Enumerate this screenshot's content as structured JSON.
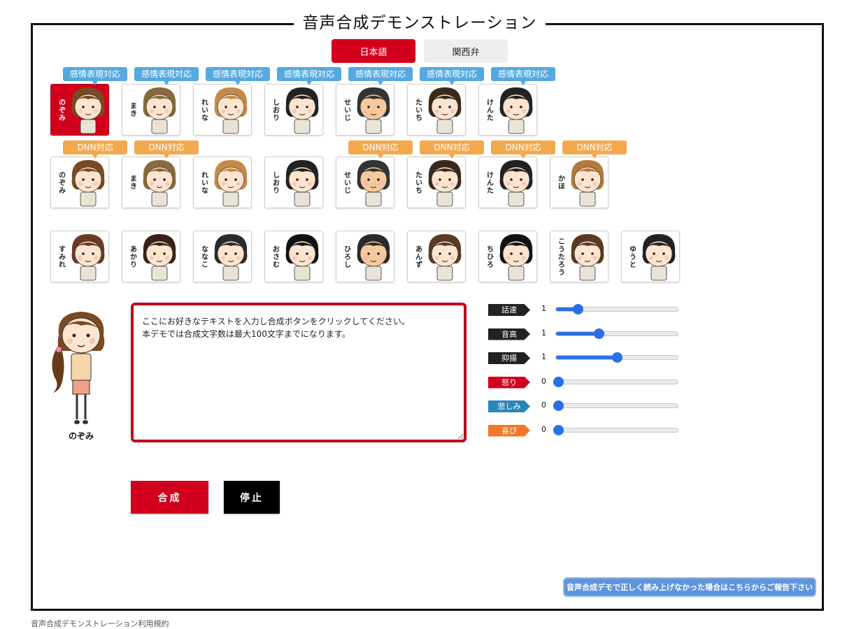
{
  "page": {
    "title": "音声合成デモンストレーション"
  },
  "language_tabs": [
    {
      "label": "日本語",
      "active": true
    },
    {
      "label": "関西弁",
      "active": false
    }
  ],
  "badges": {
    "emotion": "感情表現対応",
    "dnn": "DNN対応"
  },
  "row1": [
    {
      "name": "のぞみ",
      "hair": "#7a4a22",
      "skin": "#fde4cf",
      "badge": "emotion",
      "selected": true
    },
    {
      "name": "まき",
      "hair": "#8a6a3a",
      "skin": "#fde4cf",
      "badge": "emotion"
    },
    {
      "name": "れいな",
      "hair": "#c58a4a",
      "skin": "#fde4cf",
      "badge": "emotion"
    },
    {
      "name": "しおり",
      "hair": "#222222",
      "skin": "#fde4cf",
      "badge": "emotion"
    },
    {
      "name": "せいじ",
      "hair": "#333333",
      "skin": "#f5c99b",
      "badge": "emotion"
    },
    {
      "name": "たいち",
      "hair": "#3a2a1a",
      "skin": "#fde4cf",
      "badge": "emotion"
    },
    {
      "name": "けんた",
      "hair": "#222222",
      "skin": "#fde4cf",
      "badge": "emotion"
    }
  ],
  "row2": [
    {
      "name": "のぞみ",
      "hair": "#7a4a22",
      "skin": "#fde4cf",
      "badge": "dnn"
    },
    {
      "name": "まき",
      "hair": "#8a6a3a",
      "skin": "#fde4cf",
      "badge": "dnn"
    },
    {
      "name": "れいな",
      "hair": "#c58a4a",
      "skin": "#fde4cf",
      "badge": ""
    },
    {
      "name": "しおり",
      "hair": "#222222",
      "skin": "#fde4cf",
      "badge": ""
    },
    {
      "name": "せいじ",
      "hair": "#333333",
      "skin": "#f5c99b",
      "badge": "dnn"
    },
    {
      "name": "たいち",
      "hair": "#3a2a1a",
      "skin": "#fde4cf",
      "badge": "dnn"
    },
    {
      "name": "けんた",
      "hair": "#222222",
      "skin": "#fde4cf",
      "badge": "dnn"
    },
    {
      "name": "かほ",
      "hair": "#b5793a",
      "skin": "#fde4cf",
      "badge": "dnn"
    }
  ],
  "row3": [
    {
      "name": "すみれ",
      "hair": "#6a3a22",
      "skin": "#fde4cf"
    },
    {
      "name": "あかり",
      "hair": "#3a2218",
      "skin": "#fde4cf"
    },
    {
      "name": "ななこ",
      "hair": "#2a2a2a",
      "skin": "#fde4cf"
    },
    {
      "name": "おさむ",
      "hair": "#111111",
      "skin": "#fde4cf"
    },
    {
      "name": "ひろし",
      "hair": "#2a2a2a",
      "skin": "#f5c99b"
    },
    {
      "name": "あんず",
      "hair": "#5a3a22",
      "skin": "#fde4cf"
    },
    {
      "name": "ちひろ",
      "hair": "#111111",
      "skin": "#fde4cf"
    },
    {
      "name": "こうたろう",
      "hair": "#5a3a22",
      "skin": "#fde4cf"
    },
    {
      "name": "ゆうと",
      "hair": "#222222",
      "skin": "#fde4cf"
    }
  ],
  "selected_character": {
    "name": "のぞみ"
  },
  "text_input": {
    "value": "ここにお好きなテキストを入力し合成ボタンをクリックしてください。\n本デモでは合成文字数は最大100文字までになります。"
  },
  "params": [
    {
      "label": "話速",
      "value": "1",
      "level": 0.18,
      "color": "#222222"
    },
    {
      "label": "音高",
      "value": "1",
      "level": 0.35,
      "color": "#222222"
    },
    {
      "label": "抑揚",
      "value": "1",
      "level": 0.5,
      "color": "#222222"
    },
    {
      "label": "怒り",
      "value": "0",
      "level": 0.02,
      "color": "#d3001d"
    },
    {
      "label": "悲しみ",
      "value": "0",
      "level": 0.02,
      "color": "#2b86b8"
    },
    {
      "label": "喜び",
      "value": "0",
      "level": 0.02,
      "color": "#f0782a"
    }
  ],
  "buttons": {
    "synthesize": "合成",
    "stop": "停止"
  },
  "report_link": "音声合成デモで正しく読み上げなかった場合はこちらからご報告下さい",
  "footer": "音声合成デモンストレーション利用規約"
}
